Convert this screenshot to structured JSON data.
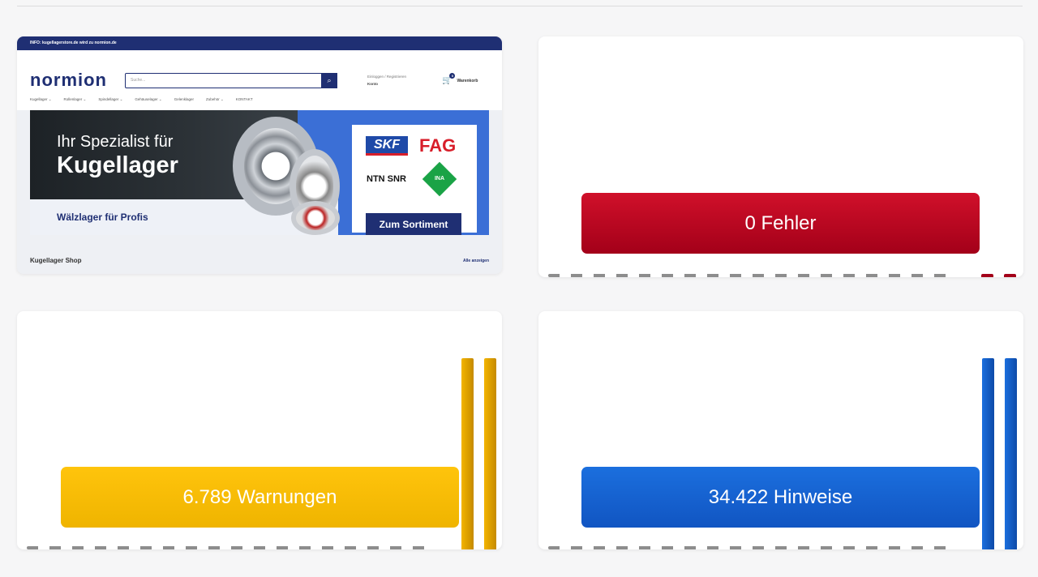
{
  "website": {
    "info_bar": "INFO: kugellagerstore.de wird zu normion.de",
    "logo": "normion",
    "search_placeholder": "Suche...",
    "account_line1": "Einloggen / Registrieren",
    "account_line2": "Konto",
    "cart_count": "0",
    "cart_label": "Warenkorb",
    "nav": [
      "Kugellager ⌄",
      "Rollenlager ⌄",
      "Spindellager ⌄",
      "Gehäuselager ⌄",
      "Gelenklager",
      "Zubehör ⌄",
      "KONTAKT"
    ],
    "hero_line1": "Ihr Spezialist für",
    "hero_line2": "Kugellager",
    "hero_sub": "Wälzlager für Profis",
    "brands": [
      "SKF",
      "FAG",
      "NTN SNR",
      "INA"
    ],
    "hero_button": "Zum Sortiment",
    "section_title": "Kugellager Shop",
    "section_link": "Alle anzeigen"
  },
  "status": {
    "errors_label": "0 Fehler",
    "warnings_label": "6.789 Warnungen",
    "hints_label": "34.422 Hinweise"
  },
  "colors": {
    "errors": "#c0001f",
    "warnings": "#fbbd08",
    "hints": "#1565d8",
    "brand": "#1f2f73"
  }
}
